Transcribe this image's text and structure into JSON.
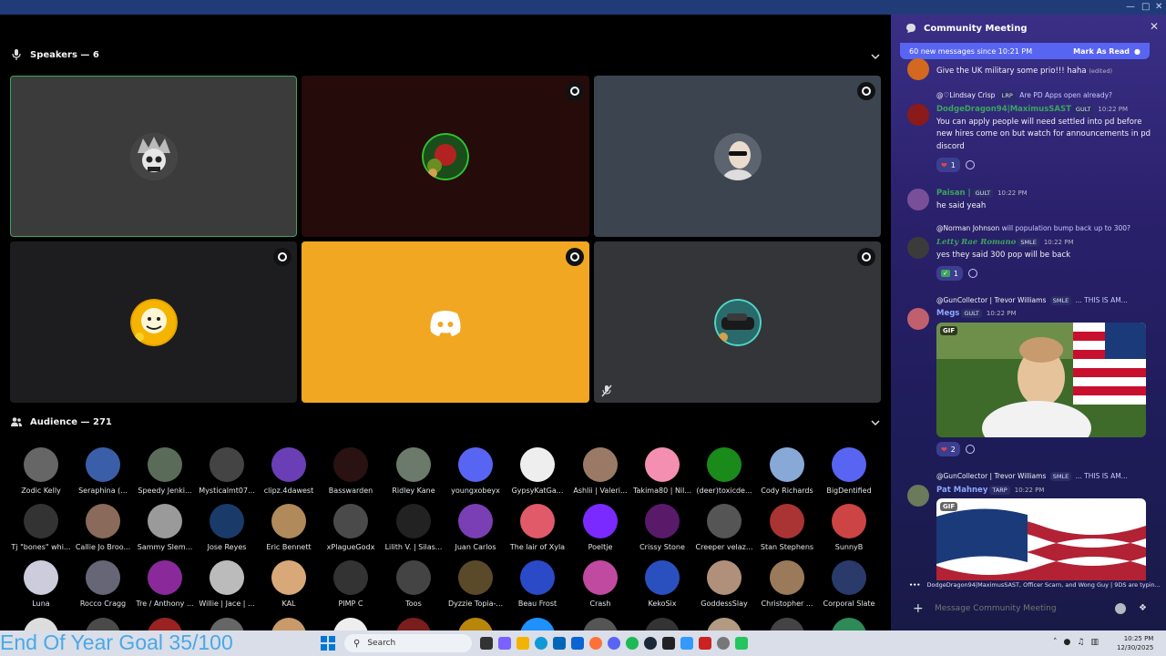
{
  "stage": {
    "speakers_label": "Speakers — 6",
    "audience_label": "Audience — 271",
    "goal_text": "End Of Year Goal 35/100"
  },
  "audience": [
    "Zodic Kelly",
    "Seraphina (...",
    "Speedy Jenki...",
    "Mysticalmt07...",
    "clipz.4dawest",
    "Basswarden",
    "Ridley Kane",
    "youngxobeyx",
    "GypsyKatGa...",
    "Ashlii | Valeri...",
    "Takima80 | Nil...",
    "(deer)toxicde...",
    "Cody Richards",
    "BigDentified",
    "Tj \"bones\" whi...",
    "Callie Jo Broo...",
    "Sammy Slem...",
    "Jose Reyes",
    "Eric Bennett",
    "xPlagueGodx",
    "Lilith V. | Silas...",
    "Juan Carlos",
    "The lair of Xyla",
    "Poeltje",
    "Crissy Stone",
    "Creeper velaz...",
    "Stan Stephens",
    "SunnyB",
    "Luna",
    "Rocco Cragg",
    "Tre / Anthony ...",
    "Willie | Jace | ...",
    "KAL",
    "PIMP C",
    "Toos",
    "Dyzzie Topia-...",
    "Beau Frost",
    "Crash",
    "KekoSix",
    "GoddessSlay",
    "Christopher ...",
    "Corporal Slate"
  ],
  "chat": {
    "title": "Community Meeting",
    "new_messages": "60 new messages since 10:21 PM",
    "mark_read": "Mark As Read",
    "m0_text": "Give the UK military some prio!!! haha",
    "m0_edited": "(edited)",
    "m1_reply_user": "@♡Lindsay Crisp",
    "m1_reply_tag": "LRP",
    "m1_reply_text": "Are PD Apps open already?",
    "m1_user": "DodgeDragon94|MaximusSAST",
    "m1_tag": "GULT",
    "m1_time": "10:22 PM",
    "m1_text": "You can apply people will need settled into pd before new hires come on but watch for announcements in pd discord",
    "m1_react": "1",
    "m2_user": "Paisan |",
    "m2_tag": "GULT",
    "m2_time": "10:22 PM",
    "m2_text": "he said yeah",
    "m3_reply_user": "@Norman Johnson",
    "m3_reply_text": "will population bump back up to 300?",
    "m3_user": "Letty Rae Romano",
    "m3_tag": "SMLE",
    "m3_time": "10:22 PM",
    "m3_text": "yes they said 300 pop will be back",
    "m3_react": "1",
    "m4_reply_user": "@GunCollector | Trevor Williams",
    "m4_reply_tag": "SMLE",
    "m4_reply_text": "... THIS IS AM...",
    "m4_user": "Megs",
    "m4_tag": "GULT",
    "m4_time": "10:22 PM",
    "gif_label": "GIF",
    "m4_react": "2",
    "m5_reply_user": "@GunCollector | Trevor Williams",
    "m5_reply_tag": "SMLE",
    "m5_reply_text": "... THIS IS AM...",
    "m5_user": "Pat Mahney",
    "m5_tag": "TARP",
    "m5_time": "10:22 PM",
    "typing": "DodgeDragon94|MaximusSAST, Officer Scarn, and Wong Guy | 9DS are typin...",
    "composer_placeholder": "Message Community Meeting"
  },
  "taskbar": {
    "search": "Search",
    "time": "10:25 PM",
    "date": "12/30/2025"
  },
  "colors": {
    "discord_blurple": "#5865f2",
    "accent_orange": "#f1a722",
    "speaking_green": "#3ba55d"
  }
}
